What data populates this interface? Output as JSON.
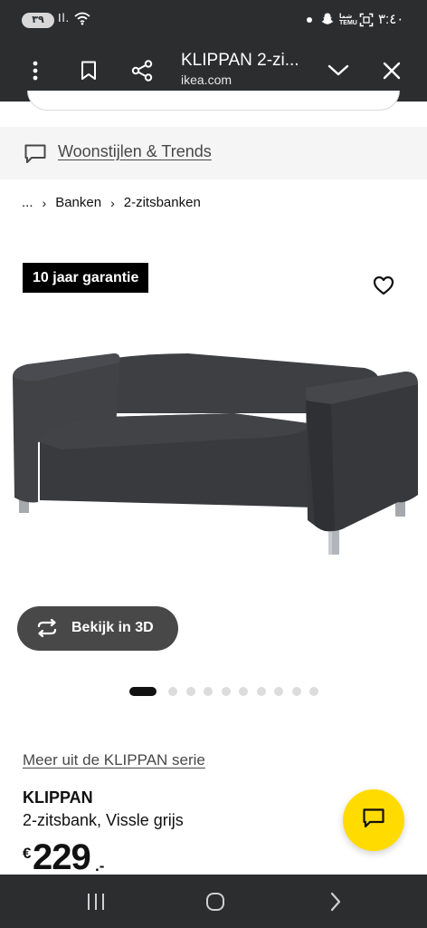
{
  "status_bar": {
    "battery": "٣٩",
    "signal": "Il.",
    "carrier_small": "TEMU",
    "time": "٣:٤٠",
    "icons": [
      "battery-icon",
      "signal-icon",
      "wifi-icon",
      "notification-dot-icon",
      "snapchat-icon",
      "temu-icon",
      "screenshot-icon"
    ]
  },
  "browser": {
    "page_title": "KLIPPAN 2-zi...",
    "url": "ikea.com",
    "icons": [
      "more-vert-icon",
      "bookmark-icon",
      "share-icon",
      "chevron-down-icon",
      "close-icon"
    ]
  },
  "banner": {
    "link_text": "Woonstijlen & Trends",
    "icon": "chat-bubble-icon"
  },
  "breadcrumb": {
    "items": [
      "...",
      "Banken",
      "2-zitsbanken"
    ],
    "separator": "›"
  },
  "product_media": {
    "badge": "10 jaar garantie",
    "view_3d_label": "Bekijk in 3D",
    "carousel_count": 10,
    "carousel_active_index": 0,
    "icons": [
      "heart-outline-icon",
      "rotate-3d-icon"
    ]
  },
  "product": {
    "series_link": "Meer uit de KLIPPAN serie",
    "name": "KLIPPAN",
    "description": "2-zitsbank, Vissle grijs",
    "price_currency": "€",
    "price_amount": "229",
    "price_suffix": ".-"
  },
  "chat_fab": {
    "icon": "chat-icon",
    "color": "#ffdb00"
  },
  "nav_bar": {
    "icons": [
      "recent-apps-icon",
      "home-icon",
      "back-icon"
    ]
  },
  "colors": {
    "system_bar": "#2b2d2f",
    "badge_bg": "#000000",
    "button_3d_bg": "#484848",
    "accent_yellow": "#ffdb00",
    "sofa_fabric": "#3d3e42"
  }
}
